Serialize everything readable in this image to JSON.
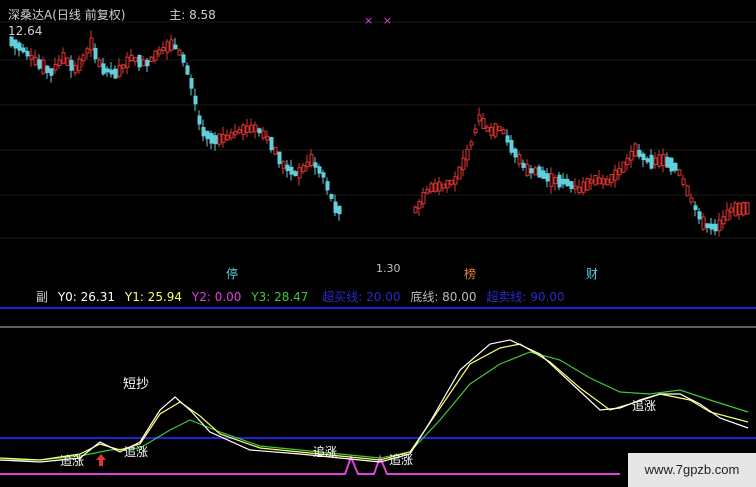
{
  "header": {
    "title": "深桑达A(日线 前复权)",
    "main_label": "主",
    "main_value": ": 8.58",
    "price_tag": "12.64",
    "marks": [
      "×",
      "×"
    ]
  },
  "main_chart": {
    "mid_label": "1.30",
    "event_labels": [
      "停",
      "榜",
      "财"
    ]
  },
  "sub_header": {
    "name": "副",
    "y0": "Y0: 26.31",
    "y1": "Y1: 25.94",
    "y2": "Y2: 0.00",
    "y3": "Y3: 28.47",
    "overbought": "超买线: 20.00",
    "bottom": "底线: 80.00",
    "oversold": "超卖线: 90.00"
  },
  "signals": {
    "short_bottom": "短抄",
    "chase1": "追涨",
    "chase2": "追涨",
    "chase3": "追涨",
    "chase4": "追涨",
    "chase5": "追涨"
  },
  "watermark": "www.7gpzb.com",
  "colors": {
    "up": "#e03434",
    "down": "#5fd0dc",
    "blue_line": "#2222dd",
    "magenta": "#e040e0",
    "y0": "#ffffff",
    "y1": "#ffff66",
    "y3": "#3cc83c"
  }
}
